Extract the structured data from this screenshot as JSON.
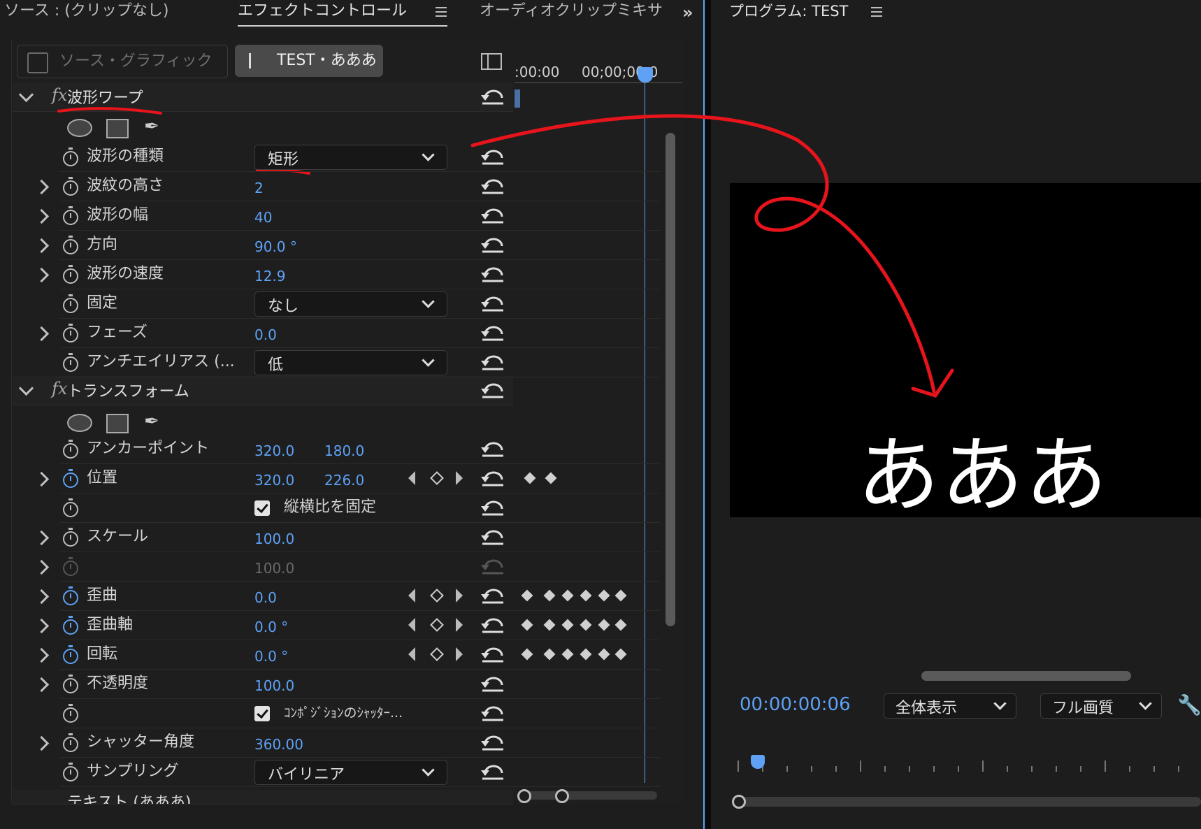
{
  "tabs": {
    "source": "ソース : (クリップなし)",
    "effect_controls": "エフェクトコントロール",
    "audio_mixer": "オーディオクリップミキサ",
    "program": "プログラム: TEST"
  },
  "clip_buttons": {
    "source_graphic": "ソース・グラフィック",
    "sequence_clip": "TEST・あああ"
  },
  "timeline_ruler": {
    "t0": ":00:00",
    "t1": "00;00;00;0"
  },
  "wave_warp": {
    "title": "波形ワープ",
    "properties": [
      {
        "label": "波形の種類",
        "value": "矩形",
        "type": "dropdown"
      },
      {
        "label": "波紋の高さ",
        "value": "2"
      },
      {
        "label": "波形の幅",
        "value": "40"
      },
      {
        "label": "方向",
        "value": "90.0 °"
      },
      {
        "label": "波形の速度",
        "value": "12.9"
      },
      {
        "label": "固定",
        "value": "なし",
        "type": "dropdown"
      },
      {
        "label": "フェーズ",
        "value": "0.0"
      },
      {
        "label": "アンチエイリアス (...",
        "value": "低",
        "type": "dropdown"
      }
    ]
  },
  "transform": {
    "title": "トランスフォーム",
    "anchor": {
      "label": "アンカーポイント",
      "x": "320.0",
      "y": "180.0"
    },
    "position": {
      "label": "位置",
      "x": "320.0",
      "y": "226.0"
    },
    "uniform_scale": {
      "label": "縦横比を固定",
      "checked": true
    },
    "scale": {
      "label": "スケール",
      "value": "100.0"
    },
    "scale_width": {
      "value": "100.0"
    },
    "skew": {
      "label": "歪曲",
      "value": "0.0"
    },
    "skew_axis": {
      "label": "歪曲軸",
      "value": "0.0 °"
    },
    "rotation": {
      "label": "回転",
      "value": "0.0 °"
    },
    "opacity": {
      "label": "不透明度",
      "value": "100.0"
    },
    "comp_shutter": {
      "label": "ｺﾝﾎﾟｼﾞｼｮﾝのｼｬｯﾀｰ...",
      "checked": true
    },
    "shutter_angle": {
      "label": "シャッター角度",
      "value": "360.00"
    },
    "sampling": {
      "label": "サンプリング",
      "value": "バイリニア"
    }
  },
  "text_section": {
    "title": "テキスト (あああ)"
  },
  "program_monitor": {
    "video_text": "あああ",
    "timecode": "00:00:00:06",
    "fit": "全体表示",
    "quality": "フル画質"
  },
  "colors": {
    "accent": "#5ea1f5",
    "annotation": "#e8141c",
    "background": "#1d1d1d"
  }
}
